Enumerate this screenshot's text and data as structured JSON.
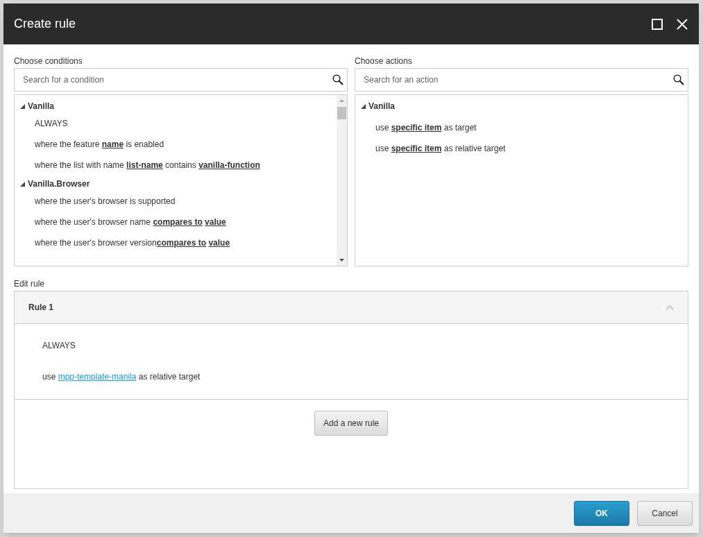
{
  "dialog": {
    "title": "Create rule"
  },
  "conditions": {
    "label": "Choose conditions",
    "search": {
      "placeholder": "Search for a condition"
    },
    "groups": [
      {
        "name": "Vanilla",
        "expanded": true,
        "children": [
          {
            "parts": [
              {
                "kind": "text",
                "text": "ALWAYS"
              }
            ]
          },
          {
            "parts": [
              {
                "kind": "text",
                "text": "where the feature "
              },
              {
                "kind": "token",
                "text": "name"
              },
              {
                "kind": "text",
                "text": " is enabled"
              }
            ]
          },
          {
            "parts": [
              {
                "kind": "text",
                "text": "where the list with name "
              },
              {
                "kind": "token",
                "text": "list-name"
              },
              {
                "kind": "text",
                "text": " contains "
              },
              {
                "kind": "token",
                "text": "vanilla-function"
              }
            ]
          }
        ]
      },
      {
        "name": "Vanilla.Browser",
        "expanded": true,
        "children": [
          {
            "parts": [
              {
                "kind": "text",
                "text": "where the user's browser is supported"
              }
            ]
          },
          {
            "parts": [
              {
                "kind": "text",
                "text": "where the user's browser name "
              },
              {
                "kind": "token",
                "text": "compares to"
              },
              {
                "kind": "token",
                "text": "value"
              }
            ]
          },
          {
            "parts": [
              {
                "kind": "text",
                "text": "where the user's browser version"
              },
              {
                "kind": "token",
                "text": "compares to"
              },
              {
                "kind": "token",
                "text": "value"
              }
            ]
          }
        ]
      }
    ]
  },
  "actions": {
    "label": "Choose actions",
    "search": {
      "placeholder": "Search for an action"
    },
    "groups": [
      {
        "name": "Vanilla",
        "expanded": true,
        "children": [
          {
            "parts": [
              {
                "kind": "text",
                "text": "use "
              },
              {
                "kind": "token",
                "text": "specific item"
              },
              {
                "kind": "text",
                "text": " as target"
              }
            ]
          },
          {
            "parts": [
              {
                "kind": "text",
                "text": "use "
              },
              {
                "kind": "token",
                "text": "specific item"
              },
              {
                "kind": "text",
                "text": " as relative target"
              }
            ]
          }
        ]
      }
    ]
  },
  "edit_rule": {
    "label": "Edit rule",
    "rules": [
      {
        "title": "Rule 1",
        "expanded": true,
        "lines": [
          {
            "parts": [
              {
                "kind": "text",
                "text": "ALWAYS"
              }
            ]
          },
          {
            "parts": [
              {
                "kind": "text",
                "text": "use "
              },
              {
                "kind": "link",
                "text": "mpp-template-manila"
              },
              {
                "kind": "text",
                "text": " as relative target"
              }
            ]
          }
        ]
      }
    ],
    "add_button": "Add a new rule"
  },
  "buttons": [
    {
      "label": "OK",
      "kind": "primary"
    },
    {
      "label": "Cancel",
      "kind": "secondary"
    }
  ]
}
